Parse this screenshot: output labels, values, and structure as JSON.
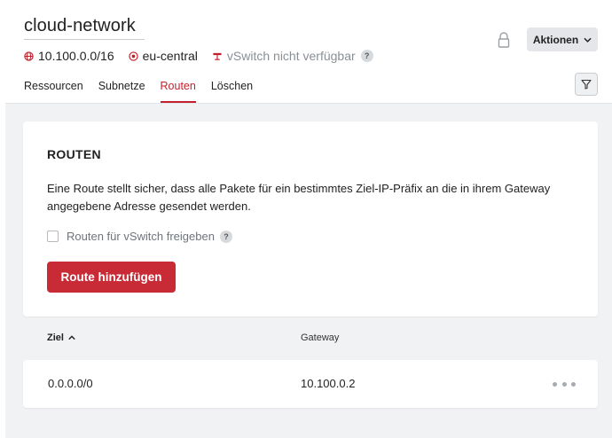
{
  "header": {
    "title": "cloud-network",
    "ip_range": "10.100.0.0/16",
    "zone": "eu-central",
    "vswitch_status": "vSwitch nicht verfügbar",
    "help_mark": "?",
    "actions_label": "Aktionen"
  },
  "tabs": [
    {
      "label": "Ressourcen",
      "active": false
    },
    {
      "label": "Subnetze",
      "active": false
    },
    {
      "label": "Routen",
      "active": true
    },
    {
      "label": "Löschen",
      "active": false
    }
  ],
  "routes_card": {
    "title": "ROUTEN",
    "description": "Eine Route stellt sicher, dass alle Pakete für ein bestimmtes Ziel-IP-Präfix an die in ihrem Gateway angegebene Adresse gesendet werden.",
    "checkbox_label": "Routen für vSwitch freigeben",
    "checkbox_checked": false,
    "help_mark": "?",
    "add_button_label": "Route hinzufügen"
  },
  "table": {
    "columns": [
      "Ziel",
      "Gateway"
    ],
    "sorted_column": "Ziel",
    "sort_direction": "ascending",
    "rows": [
      {
        "ziel": "0.0.0.0/0",
        "gateway": "10.100.0.2"
      }
    ]
  },
  "colors": {
    "accent": "#c2202d",
    "button": "#c82b36",
    "background": "#f1f2f4"
  },
  "icons": {
    "network": "globe-icon",
    "zone": "location-icon",
    "vswitch": "vswitch-icon",
    "lock": "lock-icon",
    "actions": "chevron-down-icon",
    "filter": "filter-icon",
    "sort": "chevron-up-icon",
    "row_menu": "more-dots-icon"
  }
}
